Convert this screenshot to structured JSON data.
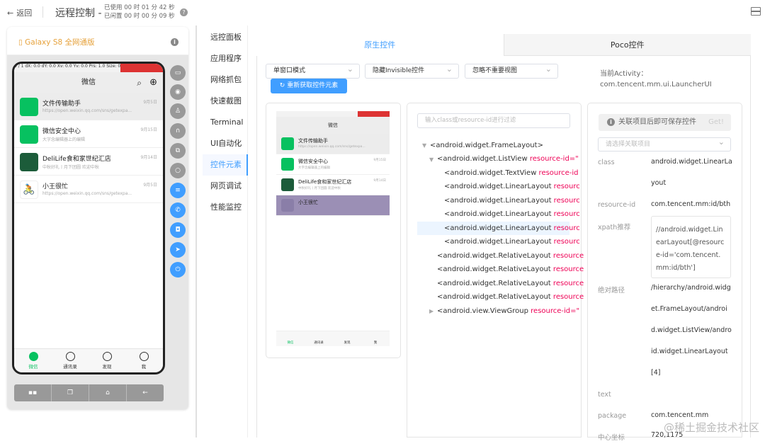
{
  "topbar": {
    "back_label": "返回",
    "title": "远程控制 -",
    "used_time": "已使用 00 时 01 分 42 秒",
    "idle_time": "已闲置 00 时 00 分 09 秒"
  },
  "device": {
    "name": "Galaxy S8 全网通版",
    "status_bar": "0 / 1   dX: 0.0   dY: 0.0   Xv: 0.0   Yv: 0.0   Prs: 1.0   Size: 0.0",
    "wechat_title": "微信",
    "chats": [
      {
        "name": "文件传输助手",
        "sub": "https://open.weixin.qq.com/sns/getexpa...",
        "time": "9月5日",
        "color": "#07c160"
      },
      {
        "name": "微信安全中心",
        "sub": "大字念编辑器上的编辑",
        "time": "9月15日",
        "color": "#07c160"
      },
      {
        "name": "DeliLife食和家世纪汇店",
        "sub": "中秋好礼丨月下团圆 欢迎中秋",
        "time": "9月14日",
        "color": "#1c5c3a"
      },
      {
        "name": "小王很忙",
        "sub": "https://open.weixin.qq.com/sns/getexpa...",
        "time": "9月5日",
        "color": "#ffffff"
      }
    ],
    "tabs": [
      "微信",
      "通讯录",
      "发现",
      "我"
    ],
    "nav_buttons": [
      "▪▪",
      "❐",
      "⌂",
      "←"
    ]
  },
  "menu": [
    "远控面板",
    "应用程序",
    "网络抓包",
    "快速截图",
    "Terminal",
    "UI自动化",
    "控件元素",
    "网页调试",
    "性能监控"
  ],
  "main_tabs": [
    "原生控件",
    "Poco控件"
  ],
  "selects": [
    "单窗口模式",
    "隐藏Invisible控件",
    "忽略不重要视图"
  ],
  "refresh_label": "重新获取控件元素",
  "activity_label": "当前Activity：",
  "activity_value": "com.tencent.mm.ui.LauncherUI",
  "filter_placeholder": "输入class或resource-id进行过滤",
  "tree": [
    {
      "cls": "<android.widget.FrameLayout>",
      "rid": ""
    },
    {
      "cls": "<android.widget.ListView ",
      "rid": "resource-id=\""
    },
    {
      "cls": "<android.widget.TextView ",
      "rid": "resource-id"
    },
    {
      "cls": "<android.widget.LinearLayout ",
      "rid": "resourc"
    },
    {
      "cls": "<android.widget.LinearLayout ",
      "rid": "resourc"
    },
    {
      "cls": "<android.widget.LinearLayout ",
      "rid": "resourc"
    },
    {
      "cls": "<android.widget.LinearLayout ",
      "rid": "resourc"
    },
    {
      "cls": "<android.widget.LinearLayout ",
      "rid": "resourc"
    },
    {
      "cls": "<android.widget.RelativeLayout ",
      "rid": "resource"
    },
    {
      "cls": "<android.widget.RelativeLayout ",
      "rid": "resource"
    },
    {
      "cls": "<android.widget.RelativeLayout ",
      "rid": "resource"
    },
    {
      "cls": "<android.widget.RelativeLayout ",
      "rid": "resource"
    },
    {
      "cls": "<android.view.ViewGroup ",
      "rid": "resource-id=\""
    }
  ],
  "props": {
    "save_hint": "关联项目后即可保存控件",
    "get_label": "Get!",
    "assoc_placeholder": "请选择关联项目",
    "class_key": "class",
    "class_val": "android.widget.LinearLayout",
    "rid_key": "resource-id",
    "rid_val": "com.tencent.mm:id/bth",
    "xpath_key": "xpath推荐",
    "xpath_val": "//android.widget.LinearLayout[@resource-id='com.tencent.mm:id/bth']",
    "abs_key": "绝对路径",
    "abs_val": "/hierarchy/android.widget.FrameLayout/android.widget.ListView/android.widget.LinearLayout[4]",
    "text_key": "text",
    "package_key": "package",
    "package_val": "com.tencent.mm",
    "center_key": "中心坐标",
    "center_val": "720,1175"
  },
  "watermark": "@稀土掘金技术社区"
}
